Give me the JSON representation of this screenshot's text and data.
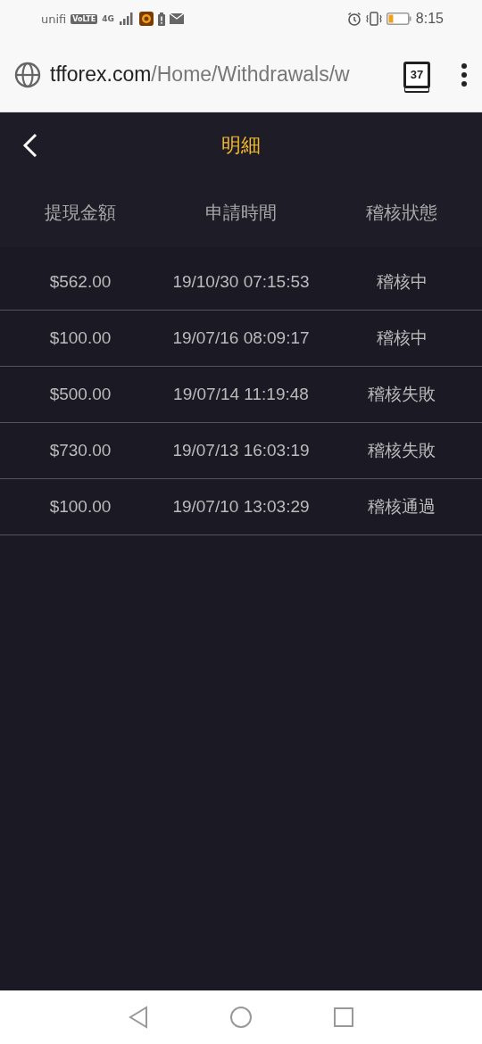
{
  "status_bar": {
    "carrier": "unifi",
    "volte": "VoLTE",
    "network": "4G",
    "time": "8:15"
  },
  "browser": {
    "url_host": "tfforex.com",
    "url_path": "/Home/Withdrawals/w",
    "tab_count": "37"
  },
  "header": {
    "title": "明細"
  },
  "table": {
    "columns": [
      "提現金額",
      "申請時間",
      "稽核狀態"
    ],
    "rows": [
      {
        "amount": "$562.00",
        "time": "19/10/30 07:15:53",
        "status": "稽核中"
      },
      {
        "amount": "$100.00",
        "time": "19/07/16 08:09:17",
        "status": "稽核中"
      },
      {
        "amount": "$500.00",
        "time": "19/07/14 11:19:48",
        "status": "稽核失敗"
      },
      {
        "amount": "$730.00",
        "time": "19/07/13 16:03:19",
        "status": "稽核失敗"
      },
      {
        "amount": "$100.00",
        "time": "19/07/10 13:03:29",
        "status": "稽核通過"
      }
    ]
  }
}
